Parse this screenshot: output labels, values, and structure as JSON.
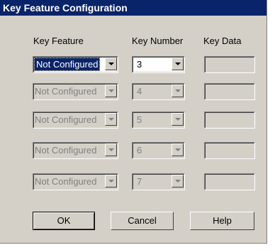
{
  "window": {
    "title": "Key Feature Configuration"
  },
  "headers": {
    "key_feature": "Key Feature",
    "key_number": "Key Number",
    "key_data": "Key Data"
  },
  "rows": [
    {
      "feature": "Not Configured",
      "number": "3",
      "data": "",
      "enabled": true
    },
    {
      "feature": "Not Configured",
      "number": "4",
      "data": "",
      "enabled": false
    },
    {
      "feature": "Not Configured",
      "number": "5",
      "data": "",
      "enabled": false
    },
    {
      "feature": "Not Configured",
      "number": "6",
      "data": "",
      "enabled": false
    },
    {
      "feature": "Not Configured",
      "number": "7",
      "data": "",
      "enabled": false
    }
  ],
  "buttons": {
    "ok": "OK",
    "cancel": "Cancel",
    "help": "Help"
  },
  "colors": {
    "titlebar": "#0a246a",
    "dialog_bg": "#d4d0c8"
  }
}
